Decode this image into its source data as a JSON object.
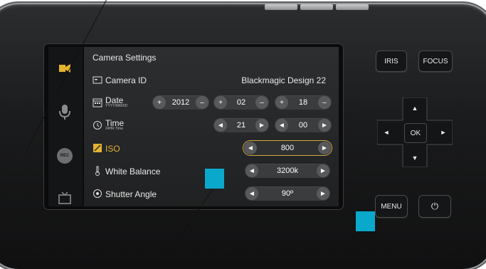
{
  "screen": {
    "title": "Camera Settings",
    "camera_id": {
      "label": "Camera ID",
      "value": "Blackmagic Design 22"
    },
    "date": {
      "label": "Date",
      "sub": "YYYY/MM/DD",
      "year": "2012",
      "month": "02",
      "day": "18"
    },
    "time": {
      "label": "Time",
      "sub": "24HR Time",
      "hour": "21",
      "minute": "00"
    },
    "iso": {
      "label": "ISO",
      "value": "800"
    },
    "white_balance": {
      "label": "White Balance",
      "value": "3200k"
    },
    "shutter_angle": {
      "label": "Shutter Angle",
      "value": "90º"
    }
  },
  "hardware": {
    "iris": "IRIS",
    "focus": "FOCUS",
    "ok": "OK",
    "menu": "MENU",
    "rec": "REC"
  },
  "colors": {
    "accent": "#e4b42e",
    "marker": "#0aa9cc"
  },
  "symbols": {
    "plus": "+",
    "minus": "–",
    "left": "◄",
    "right": "►",
    "up": "▲",
    "down": "▼",
    "power": "⏻"
  }
}
